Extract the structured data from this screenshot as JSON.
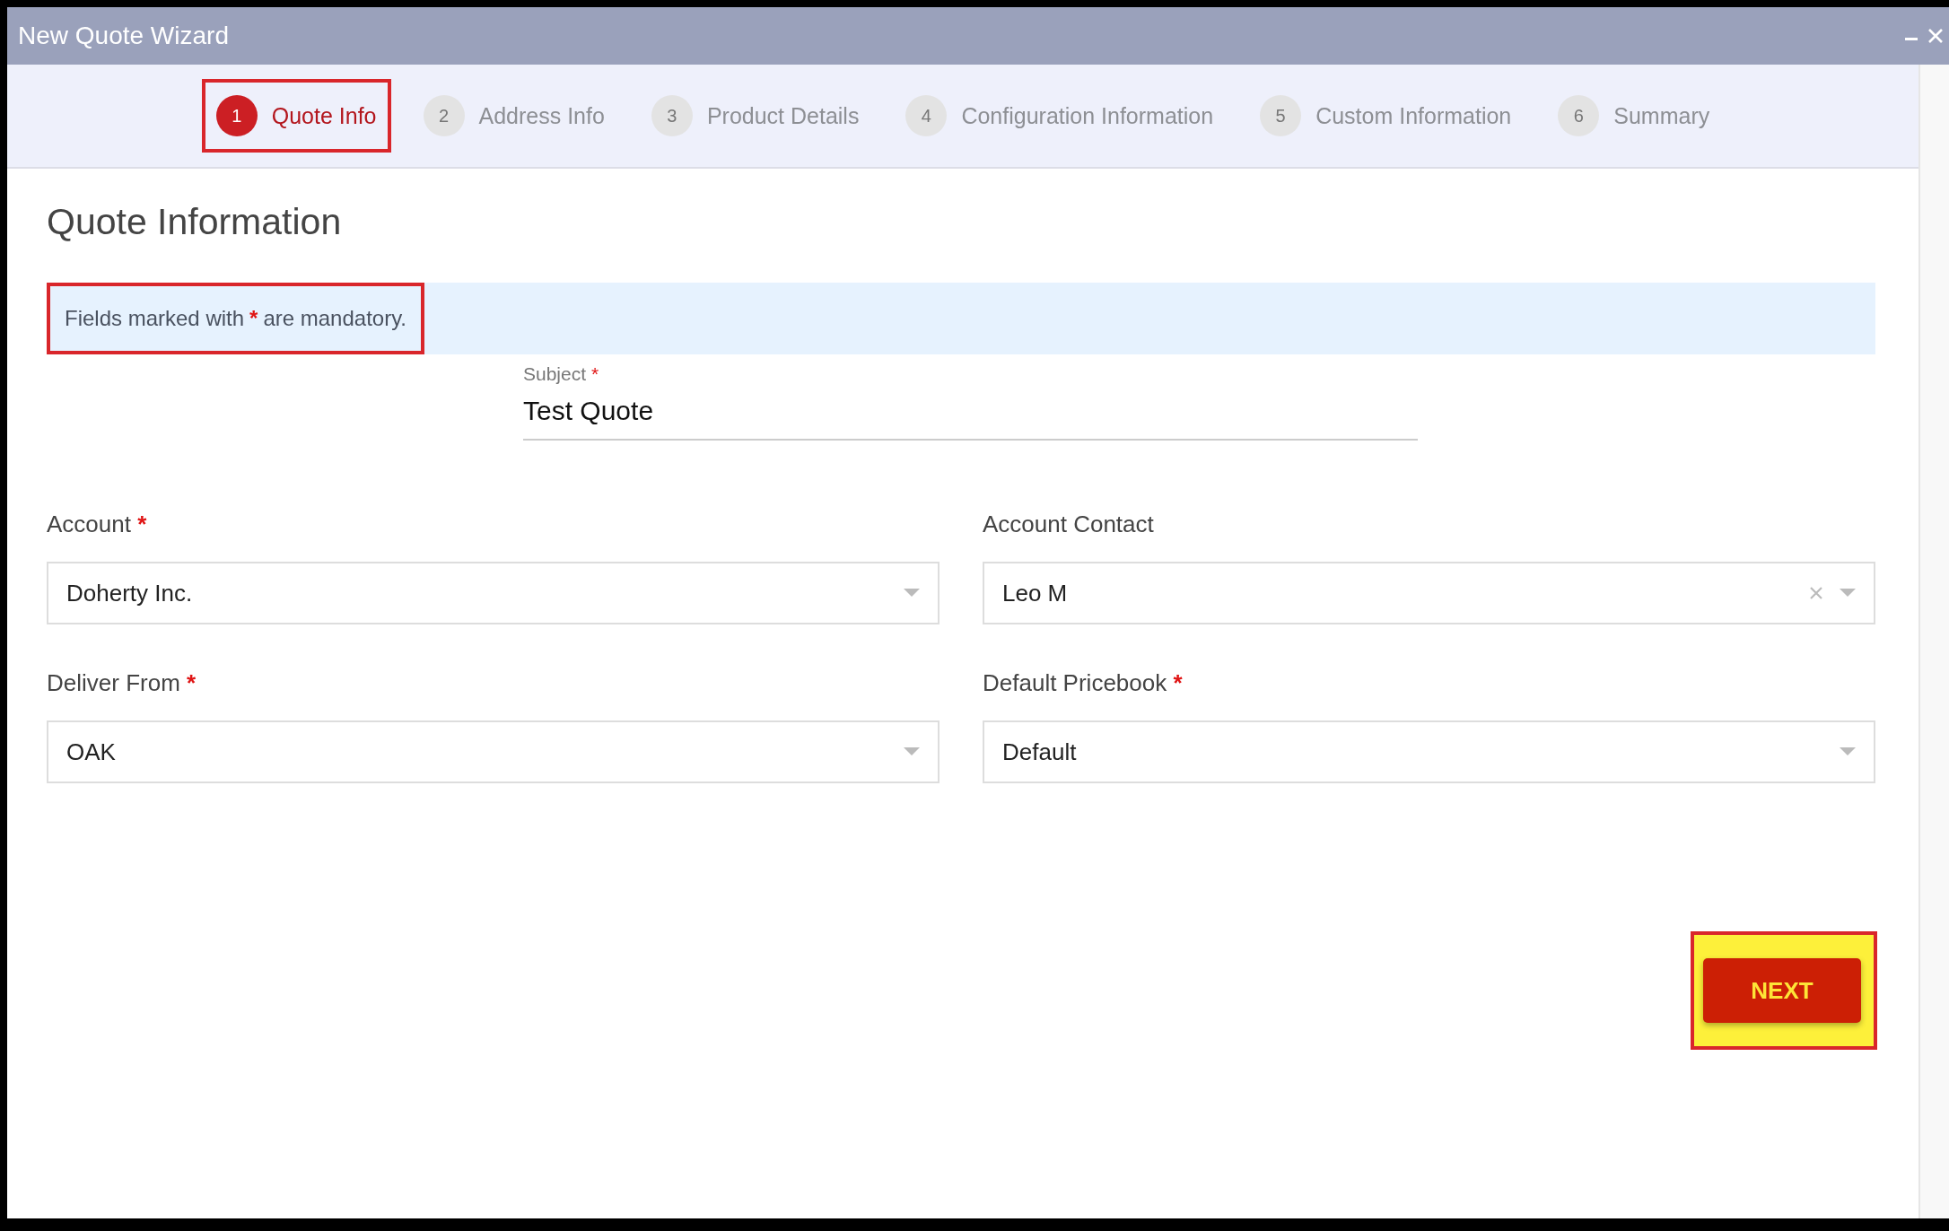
{
  "window": {
    "title": "New Quote Wizard"
  },
  "steps": [
    {
      "number": "1",
      "label": "Quote Info",
      "selected": true,
      "highlighted": true
    },
    {
      "number": "2",
      "label": "Address Info",
      "selected": false,
      "highlighted": false
    },
    {
      "number": "3",
      "label": "Product Details",
      "selected": false,
      "highlighted": false
    },
    {
      "number": "4",
      "label": "Configuration Information",
      "selected": false,
      "highlighted": false
    },
    {
      "number": "5",
      "label": "Custom Information",
      "selected": false,
      "highlighted": false
    },
    {
      "number": "6",
      "label": "Summary",
      "selected": false,
      "highlighted": false
    }
  ],
  "heading": "Quote Information",
  "notice": {
    "before": "Fields marked with",
    "mark": "*",
    "after": "are mandatory.",
    "highlighted": true
  },
  "subject": {
    "label": "Subject",
    "required": true,
    "value": "Test Quote"
  },
  "fields": [
    {
      "label": "Account",
      "required": true,
      "value": "Doherty Inc.",
      "clearable": false
    },
    {
      "label": "Account Contact",
      "required": false,
      "value": "Leo M",
      "clearable": true
    },
    {
      "label": "Deliver From",
      "required": true,
      "value": "OAK",
      "clearable": false
    },
    {
      "label": "Default Pricebook",
      "required": true,
      "value": "Default",
      "clearable": false
    }
  ],
  "next_button": {
    "label": "NEXT",
    "highlighted": true
  }
}
